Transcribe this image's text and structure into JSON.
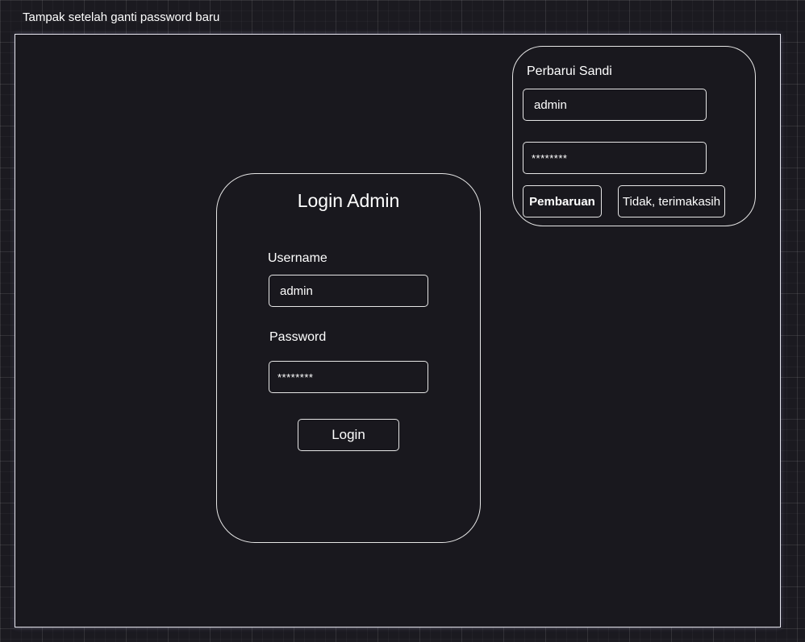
{
  "caption": "Tampak setelah ganti password baru",
  "login": {
    "title": "Login Admin",
    "username_label": "Username",
    "username_value": "admin",
    "password_label": "Password",
    "password_value": "********",
    "login_button": "Login"
  },
  "update_password": {
    "title": "Perbarui Sandi",
    "username_value": "admin",
    "password_value": "********",
    "update_button": "Pembaruan",
    "decline_button": "Tidak, terimakasih"
  }
}
